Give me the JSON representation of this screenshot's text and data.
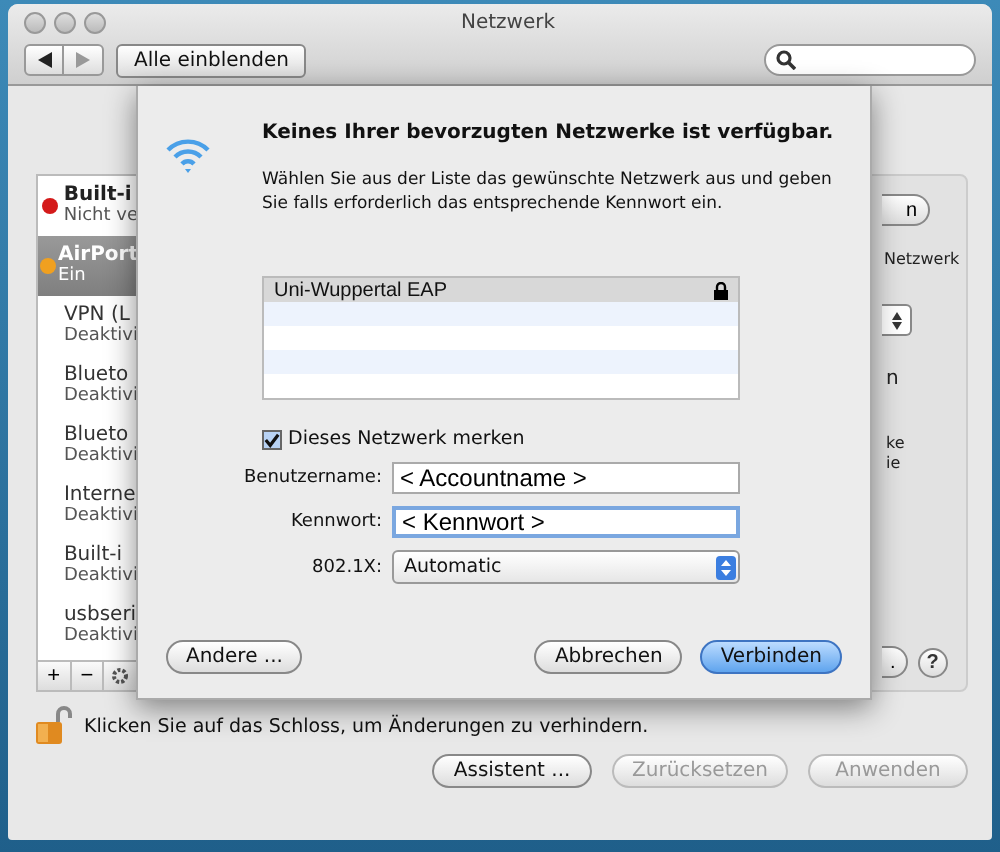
{
  "window": {
    "title": "Netzwerk",
    "show_all": "Alle einblenden"
  },
  "sidebar": {
    "items": [
      {
        "name": "Built-i",
        "status": "Nicht ve",
        "color": "#d41a1a",
        "selected": false
      },
      {
        "name": "AirPort",
        "status": "Ein",
        "color": "#f0a020",
        "selected": true
      },
      {
        "name": "VPN (L",
        "status": "Deaktivi",
        "selected": false
      },
      {
        "name": "Blueto",
        "status": "Deaktivi",
        "selected": false
      },
      {
        "name": "Blueto",
        "status": "Deaktivi",
        "selected": false
      },
      {
        "name": "Interne",
        "status": "Deaktivi",
        "selected": false
      },
      {
        "name": "Built-i",
        "status": "Deaktivi",
        "selected": false
      },
      {
        "name": "usbseri",
        "status": "Deaktivi",
        "selected": false
      }
    ],
    "buttons": [
      "+",
      "−"
    ]
  },
  "panel": {
    "button_1": "n",
    "text_1": "Netzwerk",
    "text_2": "n",
    "text_3": "ke",
    "text_4": "ie",
    "button_2": ".",
    "help": "?"
  },
  "sheet": {
    "title": "Keines Ihrer bevorzugten Netzwerke ist verfügbar.",
    "message": "Wählen Sie aus der Liste das gewünschte Netzwerk aus und geben Sie falls erforderlich das entsprechende Kennwort ein.",
    "networks": [
      {
        "name": "Uni-Wuppertal EAP",
        "secured": true,
        "selected": true
      }
    ],
    "remember": {
      "label": "Dieses Netzwerk merken",
      "checked": true
    },
    "fields": [
      {
        "kind": "text",
        "label": "Benutzername:",
        "value": "< Accountname >",
        "focused": false
      },
      {
        "kind": "text",
        "label": "Kennwort:",
        "value": "< Kennwort >",
        "focused": true
      },
      {
        "kind": "select",
        "label": "802.1X:",
        "value": "Automatic"
      }
    ],
    "left_button": "Andere ...",
    "buttons": [
      {
        "label": "Abbrechen",
        "default": false
      },
      {
        "label": "Verbinden",
        "default": true
      }
    ]
  },
  "lock_text": "Klicken Sie auf das Schloss, um Änderungen zu verhindern.",
  "bottom_buttons": [
    {
      "label": "Assistent ...",
      "disabled": false
    },
    {
      "label": "Zurücksetzen",
      "disabled": true
    },
    {
      "label": "Anwenden",
      "disabled": true
    }
  ]
}
